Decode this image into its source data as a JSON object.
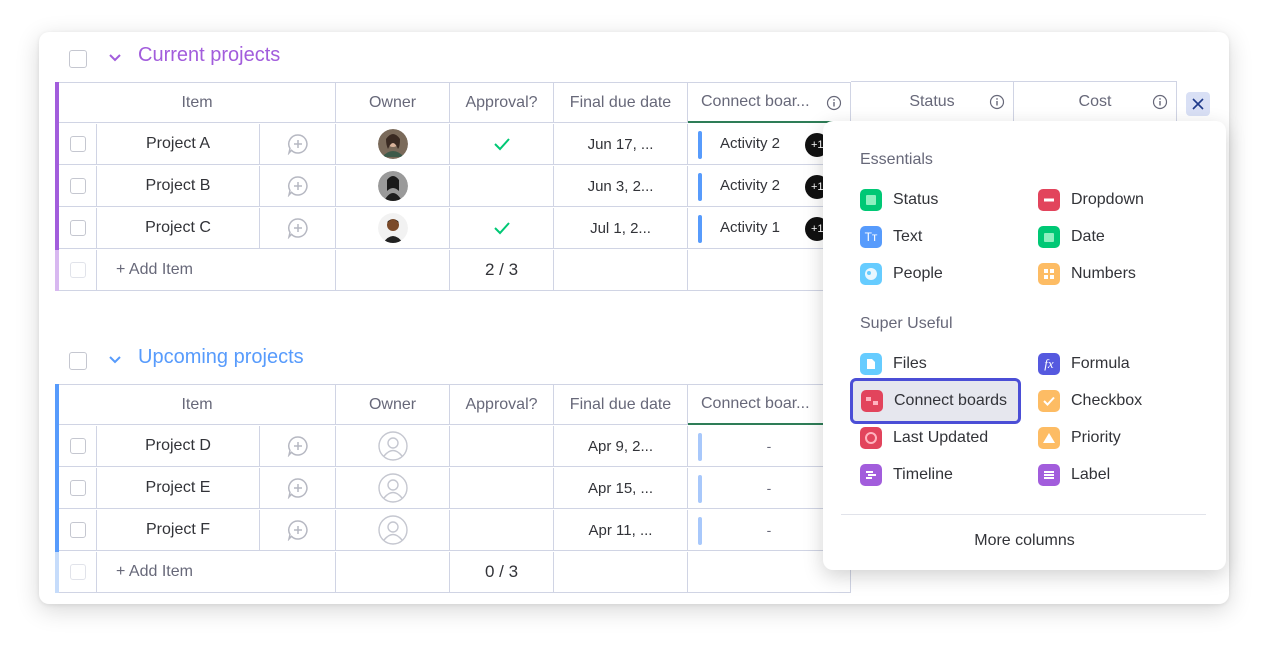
{
  "groups": [
    {
      "title": "Current projects",
      "color": "#a25ddc",
      "columns": [
        "Item",
        "Owner",
        "Approval?",
        "Final due date",
        "Connect boar...",
        "Status",
        "Cost"
      ],
      "rows": [
        {
          "name": "Project A",
          "approved": true,
          "due": "Jun 17, ...",
          "connect": "Activity 2",
          "badge": "+1"
        },
        {
          "name": "Project B",
          "approved": false,
          "due": "Jun 3, 2...",
          "connect": "Activity 2",
          "badge": "+1"
        },
        {
          "name": "Project C",
          "approved": true,
          "due": "Jul 1, 2...",
          "connect": "Activity 1",
          "badge": "+1"
        }
      ],
      "add_item": "+ Add Item",
      "approval_summary": "2 / 3"
    },
    {
      "title": "Upcoming projects",
      "color": "#579bfc",
      "columns": [
        "Item",
        "Owner",
        "Approval?",
        "Final due date",
        "Connect boar..."
      ],
      "rows": [
        {
          "name": "Project D",
          "due": "Apr 9, 2...",
          "connect": "-"
        },
        {
          "name": "Project E",
          "due": "Apr 15, ...",
          "connect": "-"
        },
        {
          "name": "Project F",
          "due": "Apr 11, ...",
          "connect": "-"
        }
      ],
      "add_item": "+ Add Item",
      "approval_summary": "0 / 3"
    }
  ],
  "column_picker": {
    "essentials_title": "Essentials",
    "essentials": [
      {
        "label": "Status",
        "icon": "status-icon",
        "color": "#00c875"
      },
      {
        "label": "Dropdown",
        "icon": "dropdown-icon",
        "color": "#e2445c"
      },
      {
        "label": "Text",
        "icon": "text-icon",
        "color": "#579bfc"
      },
      {
        "label": "Date",
        "icon": "date-icon",
        "color": "#00c875"
      },
      {
        "label": "People",
        "icon": "people-icon",
        "color": "#66ccff"
      },
      {
        "label": "Numbers",
        "icon": "numbers-icon",
        "color": "#fdbc64"
      }
    ],
    "useful_title": "Super Useful",
    "useful": [
      {
        "label": "Files",
        "icon": "files-icon",
        "color": "#66ccff"
      },
      {
        "label": "Formula",
        "icon": "formula-icon",
        "color": "#5559df"
      },
      {
        "label": "Connect boards",
        "icon": "connect-boards-icon",
        "color": "#e2445c"
      },
      {
        "label": "Checkbox",
        "icon": "checkbox-icon",
        "color": "#fdbc64"
      },
      {
        "label": "Last Updated",
        "icon": "last-updated-icon",
        "color": "#e2445c"
      },
      {
        "label": "Priority",
        "icon": "priority-icon",
        "color": "#fdbc64"
      },
      {
        "label": "Timeline",
        "icon": "timeline-icon",
        "color": "#a25ddc"
      },
      {
        "label": "Label",
        "icon": "label-icon",
        "color": "#a25ddc"
      }
    ],
    "more": "More columns"
  }
}
